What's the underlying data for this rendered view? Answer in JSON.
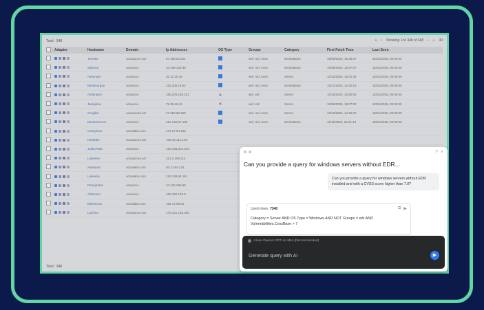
{
  "table": {
    "total_label": "Total : 348",
    "pagination": {
      "prev_first": "«",
      "prev": "‹",
      "showing": "Showing 1 to 348 of 348",
      "next": "›",
      "next_last": "»",
      "page_size": "30"
    },
    "headers": [
      "Adapter",
      "Hostname",
      "Domain",
      "Ip Addresses",
      "OS Type",
      "Groups",
      "Category",
      "First Fetch Time",
      "Last Seen"
    ],
    "rows": [
      {
        "host": "Tomitas",
        "domain": "octoxazure.azr",
        "ip": "87.189.63.211",
        "os": "windows",
        "groups": "wef, md, mvm",
        "category": "Workstation",
        "first": "10/09/2025, 15:48:07",
        "last": "12/01/2025, 09:00:00"
      },
      {
        "host": "Silamne",
        "domain": "octoxis.io",
        "ip": "10.168.130.30",
        "os": "windows",
        "groups": "wef, md, mvm",
        "category": "Workstation",
        "first": "10/09/2025, 16:07:07",
        "last": "12/01/2025, 09:00:00"
      },
      {
        "host": "Ashenjuirr",
        "domain": "octoxis.io",
        "ip": "10.12.25.28",
        "os": "windows",
        "groups": "wef, md, mvm",
        "category": "Server",
        "first": "10/22/2025, 15:00:35",
        "last": "12/01/2025, 09:00:00"
      },
      {
        "host": "Markmorgan",
        "domain": "octoxis.io",
        "ip": "222.205.16.62",
        "os": "windows",
        "groups": "wef, md, mvm",
        "category": "Workstation",
        "first": "10/21/2025, 14:30:16",
        "last": "12/01/2025, 09:00:00"
      },
      {
        "host": "Ashenjuirn",
        "domain": "octoxis.io",
        "ip": "185.204.194.221",
        "os": "linux",
        "groups": "wef, edr",
        "category": "Server",
        "first": "10/20/2025, 15:50:55",
        "last": "12/01/2025, 09:00:00"
      },
      {
        "host": "Jadejulian",
        "domain": "octoxis.io",
        "ip": "75.28.46.16",
        "os": "linux",
        "groups": "wef, edr",
        "category": "Server",
        "first": "10/09/2025, 16:07:02",
        "last": "12/01/2025, 09:00:00"
      },
      {
        "host": "Gregllos",
        "domain": "octoxazure.azr",
        "ip": "27.254.80.198",
        "os": "windows",
        "groups": "wef, md, mvm",
        "category": "Server",
        "first": "10/23/2025, 14:45:20",
        "last": "12/01/2025, 09:00:00"
      },
      {
        "host": "Markcameron",
        "domain": "octoxis.io",
        "ip": "212.142.67.180",
        "os": "windows",
        "groups": "wef, md, mvm",
        "category": "Workstation",
        "first": "10/11/2025, 21:21:10",
        "last": "12/01/2025, 09:00:00"
      },
      {
        "host": "Caseyloeo",
        "domain": "octoxlabs.com",
        "ip": "172.27.54.146",
        "os": "",
        "groups": "",
        "category": "",
        "first": "",
        "last": ""
      },
      {
        "host": "Kaesbbit",
        "domain": "octoxazure.azr",
        "ip": "193.49.114.128",
        "os": "",
        "groups": "",
        "category": "",
        "first": "",
        "last": ""
      },
      {
        "host": "Julian7892",
        "domain": "octoxis.io",
        "ip": "192.168.201.234",
        "os": "",
        "groups": "",
        "category": "",
        "first": "",
        "last": ""
      },
      {
        "host": "Lukeelse",
        "domain": "octoxazure.azr",
        "ip": "221.2.108.114",
        "os": "",
        "groups": "",
        "category": "",
        "first": "",
        "last": ""
      },
      {
        "host": "Alexanna",
        "domain": "octoxlabs.com",
        "ip": "92.3.164.134",
        "os": "",
        "groups": "",
        "category": "",
        "first": "",
        "last": ""
      },
      {
        "host": "Lukeelse",
        "domain": "octoxlabs.com",
        "ip": "192.168.64.161",
        "os": "",
        "groups": "",
        "category": "",
        "first": "",
        "last": ""
      },
      {
        "host": "Peterjordan",
        "domain": "octoxis.io",
        "ip": "10.126.255.65",
        "os": "",
        "groups": "",
        "category": "",
        "first": "",
        "last": ""
      },
      {
        "host": "Adamium",
        "domain": "octoxis.io",
        "ip": "162.192.170.8",
        "os": "",
        "groups": "",
        "category": "",
        "first": "",
        "last": ""
      },
      {
        "host": "Elisemoon",
        "domain": "octoxlabs.com",
        "ip": "194.72.69.61",
        "os": "",
        "groups": "",
        "category": "",
        "first": "",
        "last": ""
      },
      {
        "host": "Liamfox",
        "domain": "octoxazure.azr",
        "ip": "170.121.130.250",
        "os": "",
        "groups": "",
        "category": "",
        "first": "",
        "last": ""
      }
    ],
    "footer_total": "Total : 348"
  },
  "assistant": {
    "title": "Can you provide a query for windows servers without EDR...",
    "user_message": "Can you provide a query for windows servers without EDR installed and with a CVSS score higher than 7.0?",
    "used_token_label": "Used token:",
    "used_token_value": "7340",
    "query_text": "Category = Server AND OS.Type = Windows AND NOT Groups = edr AND Vulnerabilities.CvssBase > 7",
    "model_label": "Azure OpenAI GPT-4o Mini (Recommended)",
    "input_placeholder": "Generate query with AI",
    "send_icon": "▶",
    "help_icon": "?",
    "close_icon": "×",
    "copy_icon": "⧉",
    "run_icon": "▶"
  },
  "colors": {
    "background": "#0b1a4a",
    "accent": "#5fd6a4",
    "send": "#2f7bf5"
  }
}
